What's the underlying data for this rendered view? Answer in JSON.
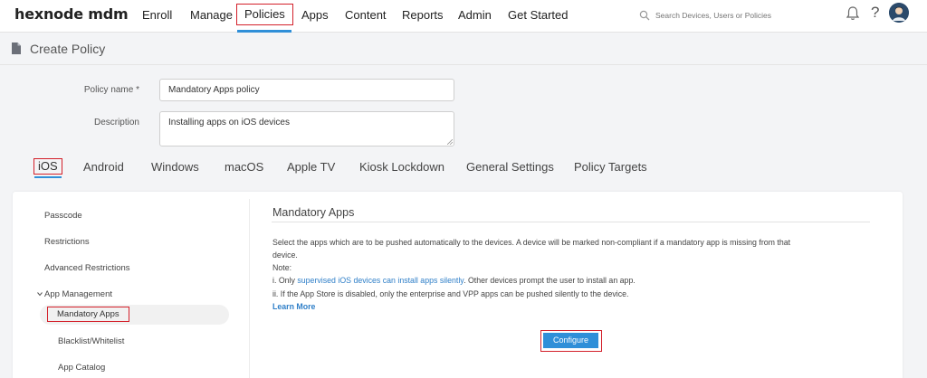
{
  "brand": "hexnode mdm",
  "nav": {
    "items": [
      "Enroll",
      "Manage",
      "Policies",
      "Apps",
      "Content",
      "Reports",
      "Admin",
      "Get Started"
    ]
  },
  "search": {
    "placeholder": "Search Devices, Users or Policies"
  },
  "page": {
    "title": "Create Policy"
  },
  "form": {
    "policy_name_label": "Policy name *",
    "policy_name_value": "Mandatory Apps policy",
    "description_label": "Description",
    "description_value": "Installing apps on iOS devices"
  },
  "platform_tabs": [
    "iOS",
    "Android",
    "Windows",
    "macOS",
    "Apple TV",
    "Kiosk Lockdown",
    "General Settings",
    "Policy Targets"
  ],
  "sidebar": {
    "items": [
      "Passcode",
      "Restrictions",
      "Advanced Restrictions",
      "App Management",
      "Mandatory Apps",
      "Blacklist/Whitelist",
      "App Catalog"
    ]
  },
  "content": {
    "title": "Mandatory Apps",
    "line1": "Select the apps which are to be pushed automatically to the devices. A device will be marked non-compliant if a mandatory app is missing from that",
    "line2": "device.",
    "note_label": "Note:",
    "note1_prefix": "i. Only ",
    "note1_link": "supervised iOS devices can install apps silently",
    "note1_suffix": ". Other devices prompt the user to install an app.",
    "note2": "ii. If the App Store is disabled, only the enterprise and VPP apps can be pushed silently to the device.",
    "learn_more": "Learn More",
    "configure_label": "Configure"
  },
  "colors": {
    "accent": "#2f8fd8",
    "highlight": "#d3202a"
  }
}
